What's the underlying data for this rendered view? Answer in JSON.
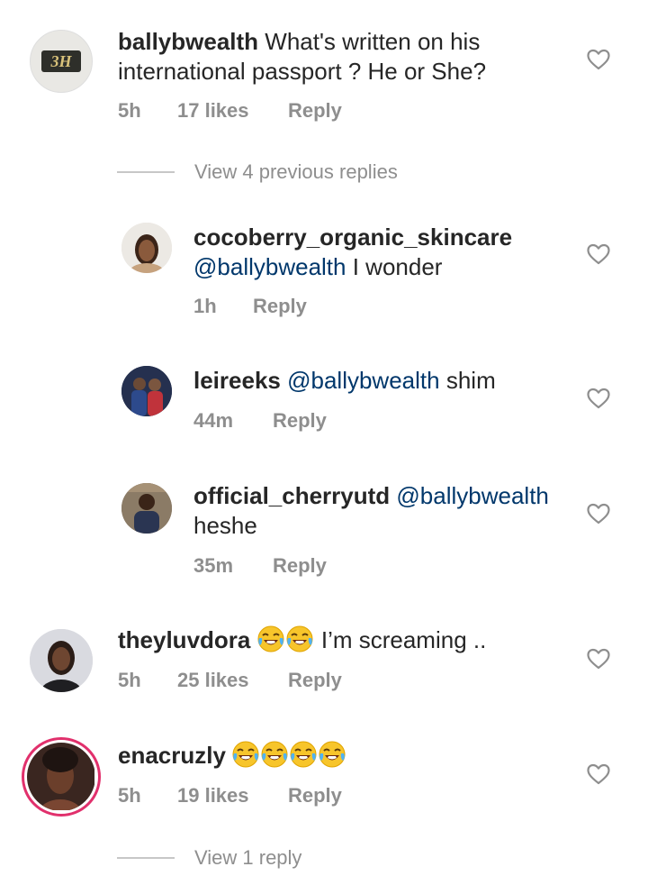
{
  "comments": [
    {
      "username": "ballybwealth",
      "text": "What's written on his international passport ? He or She?",
      "time": "5h",
      "likes": "17 likes",
      "reply": "Reply"
    },
    {
      "username": "cocoberry_organic_skincare",
      "mention": "@ballybwealth",
      "text": "I wonder",
      "time": "1h",
      "reply": "Reply"
    },
    {
      "username": "leireeks",
      "mention": "@ballybwealth",
      "text": "shim",
      "time": "44m",
      "reply": "Reply"
    },
    {
      "username": "official_cherryutd",
      "mention": "@ballybwealth",
      "text": "heshe",
      "time": "35m",
      "reply": "Reply"
    },
    {
      "username": "theyluvdora",
      "text": "I’m screaming ..",
      "time": "5h",
      "likes": "25 likes",
      "reply": "Reply"
    },
    {
      "username": "enacruzly",
      "time": "5h",
      "likes": "19 likes",
      "reply": "Reply"
    }
  ],
  "view_previous": "View 4 previous replies",
  "view_reply": "View 1 reply",
  "avatar_logo_text": "3H",
  "icons": {
    "like": "heart-outline-icon",
    "emoji": "face-with-tears-of-joy"
  },
  "colors": {
    "text": "#262626",
    "meta": "#8e8e8e",
    "mention": "#00376b",
    "story_ring": "#e1306c"
  }
}
